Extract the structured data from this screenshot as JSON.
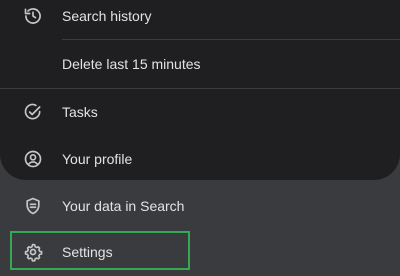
{
  "menu": {
    "items": [
      {
        "label": "Search history",
        "icon": "history-icon"
      },
      {
        "label": "Delete last 15 minutes"
      },
      {
        "label": "Tasks",
        "icon": "check-circle-icon"
      },
      {
        "label": "Your profile",
        "icon": "account-circle-icon"
      },
      {
        "label": "Your data in Search",
        "icon": "shield-icon"
      },
      {
        "label": "Settings",
        "icon": "gear-icon",
        "highlighted": true
      }
    ]
  },
  "colors": {
    "background": "#1f1f21",
    "lower_surface": "#3a3b3e",
    "text": "#e3e3e3",
    "icon": "#c4c7c5",
    "highlight_border": "#34a853"
  }
}
